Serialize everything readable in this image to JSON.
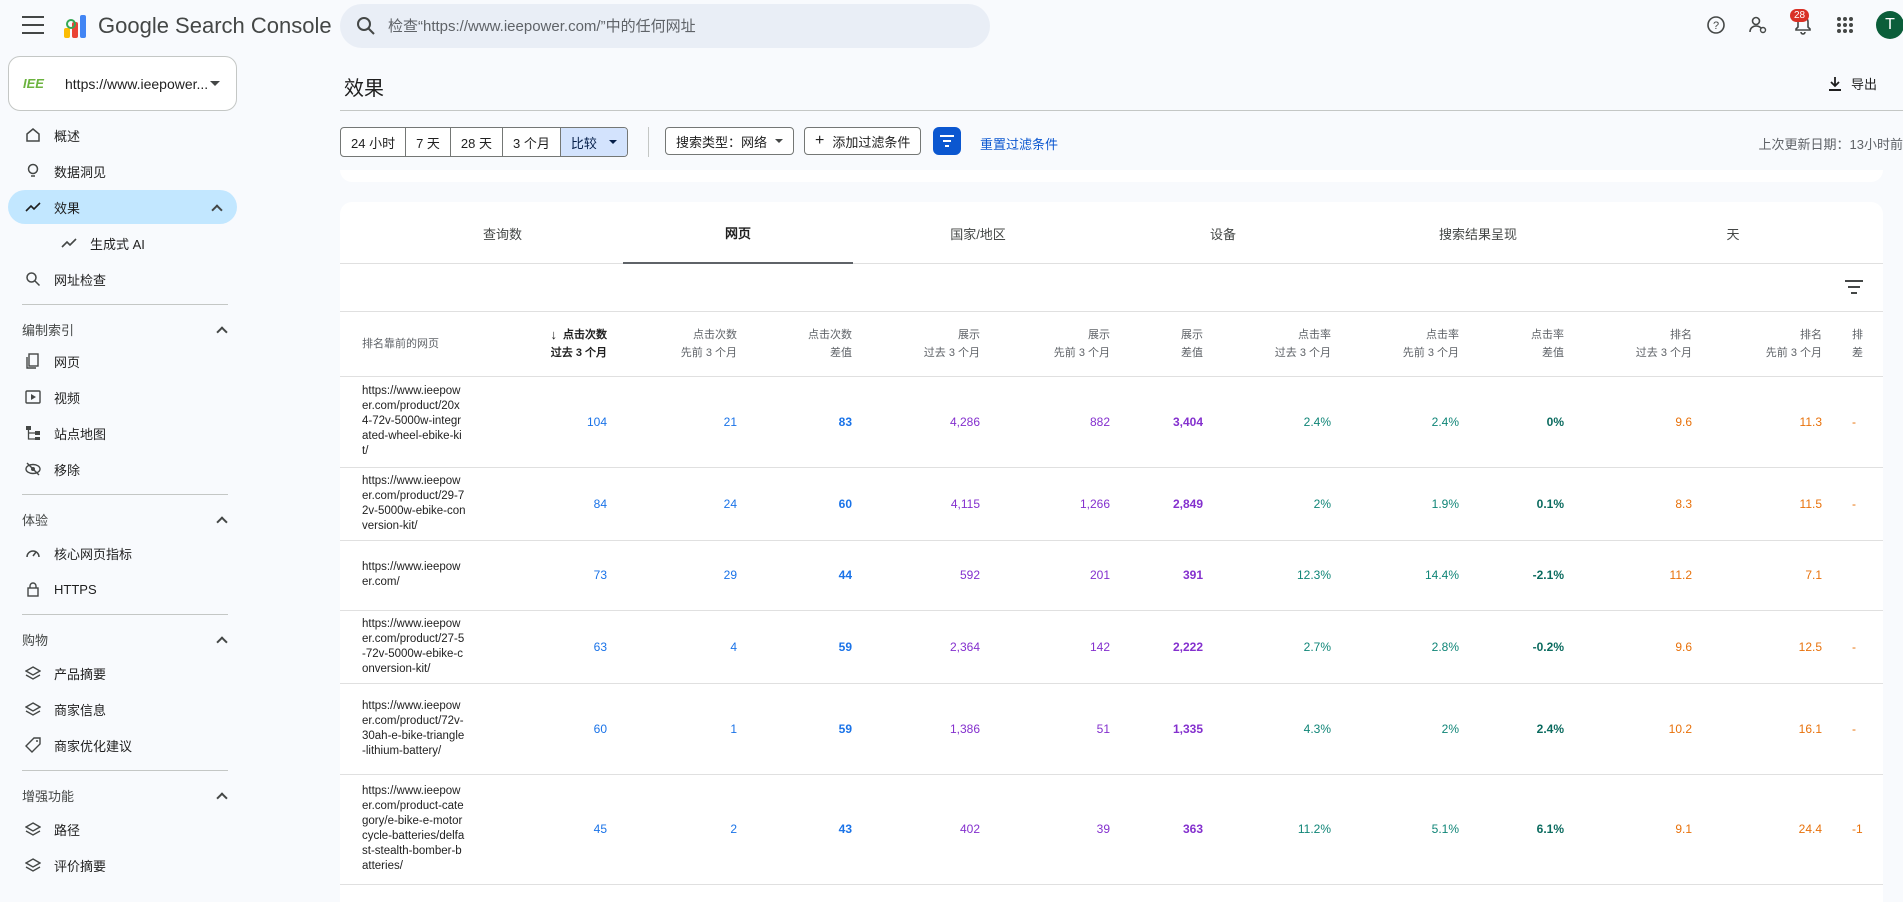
{
  "header": {
    "app_title": "Google Search Console",
    "search_placeholder": "检查“https://www.ieepower.com/”中的任何网址",
    "notification_count": "28",
    "avatar_letter": "T"
  },
  "sidebar": {
    "property_logo": "IEE",
    "property_name": "https://www.ieepower...",
    "nav": {
      "overview": "概述",
      "insights": "数据洞见",
      "performance": "效果",
      "generative_ai": "生成式 AI",
      "url_inspection": "网址检查"
    },
    "indexing": {
      "title": "编制索引",
      "pages": "网页",
      "videos": "视频",
      "sitemaps": "站点地图",
      "removals": "移除"
    },
    "experience": {
      "title": "体验",
      "cwv": "核心网页指标",
      "https": "HTTPS"
    },
    "shopping": {
      "title": "购物",
      "product_snippets": "产品摘要",
      "merchant_listings": "商家信息",
      "merchant_opportunities": "商家优化建议"
    },
    "enhancements": {
      "title": "增强功能",
      "breadcrumbs": "路径",
      "review_snippets": "评价摘要"
    }
  },
  "main": {
    "title": "效果",
    "export_label": "导出",
    "ranges": [
      "24 小时",
      "7 天",
      "28 天",
      "3 个月",
      "比较"
    ],
    "search_type": "搜索类型：网络",
    "add_filter": "添加过滤条件",
    "reset_filters": "重置过滤条件",
    "last_update": "上次更新日期：13小时前"
  },
  "tabs": [
    "查询数",
    "网页",
    "国家/地区",
    "设备",
    "搜索结果呈现",
    "天"
  ],
  "table": {
    "page_header": "排名靠前的网页",
    "columns": [
      {
        "top": "点击次数",
        "bottom": "过去 3 个月",
        "sorted": true
      },
      {
        "top": "点击次数",
        "bottom": "先前 3 个月"
      },
      {
        "top": "点击次数",
        "bottom": "差值"
      },
      {
        "top": "展示",
        "bottom": "过去 3 个月"
      },
      {
        "top": "展示",
        "bottom": "先前 3 个月"
      },
      {
        "top": "展示",
        "bottom": "差值"
      },
      {
        "top": "点击率",
        "bottom": "过去 3 个月"
      },
      {
        "top": "点击率",
        "bottom": "先前 3 个月"
      },
      {
        "top": "点击率",
        "bottom": "差值"
      },
      {
        "top": "排名",
        "bottom": "过去 3 个月"
      },
      {
        "top": "排名",
        "bottom": "先前 3 个月"
      },
      {
        "top": "排",
        "bottom": "差"
      }
    ],
    "rows": [
      {
        "url": "https://www.ieepower.com/product/20x4-72v-5000w-integrated-wheel-ebike-kit/",
        "v": [
          "104",
          "21",
          "83",
          "4,286",
          "882",
          "3,404",
          "2.4%",
          "2.4%",
          "0%",
          "9.6",
          "11.3",
          "-"
        ]
      },
      {
        "url": "https://www.ieepower.com/product/29-72v-5000w-ebike-conversion-kit/",
        "v": [
          "84",
          "24",
          "60",
          "4,115",
          "1,266",
          "2,849",
          "2%",
          "1.9%",
          "0.1%",
          "8.3",
          "11.5",
          "-"
        ]
      },
      {
        "url": "https://www.ieepower.com/",
        "v": [
          "73",
          "29",
          "44",
          "592",
          "201",
          "391",
          "12.3%",
          "14.4%",
          "-2.1%",
          "11.2",
          "7.1",
          ""
        ]
      },
      {
        "url": "https://www.ieepower.com/product/27-5-72v-5000w-ebike-conversion-kit/",
        "v": [
          "63",
          "4",
          "59",
          "2,364",
          "142",
          "2,222",
          "2.7%",
          "2.8%",
          "-0.2%",
          "9.6",
          "12.5",
          "-"
        ]
      },
      {
        "url": "https://www.ieepower.com/product/72v-30ah-e-bike-triangle-lithium-battery/",
        "v": [
          "60",
          "1",
          "59",
          "1,386",
          "51",
          "1,335",
          "4.3%",
          "2%",
          "2.4%",
          "10.2",
          "16.1",
          "-"
        ]
      },
      {
        "url": "https://www.ieepower.com/product-category/e-bike-e-motorcycle-batteries/delfast-stealth-bomber-batteries/",
        "v": [
          "45",
          "2",
          "43",
          "402",
          "39",
          "363",
          "11.2%",
          "5.1%",
          "6.1%",
          "9.1",
          "24.4",
          "-1"
        ]
      }
    ]
  }
}
